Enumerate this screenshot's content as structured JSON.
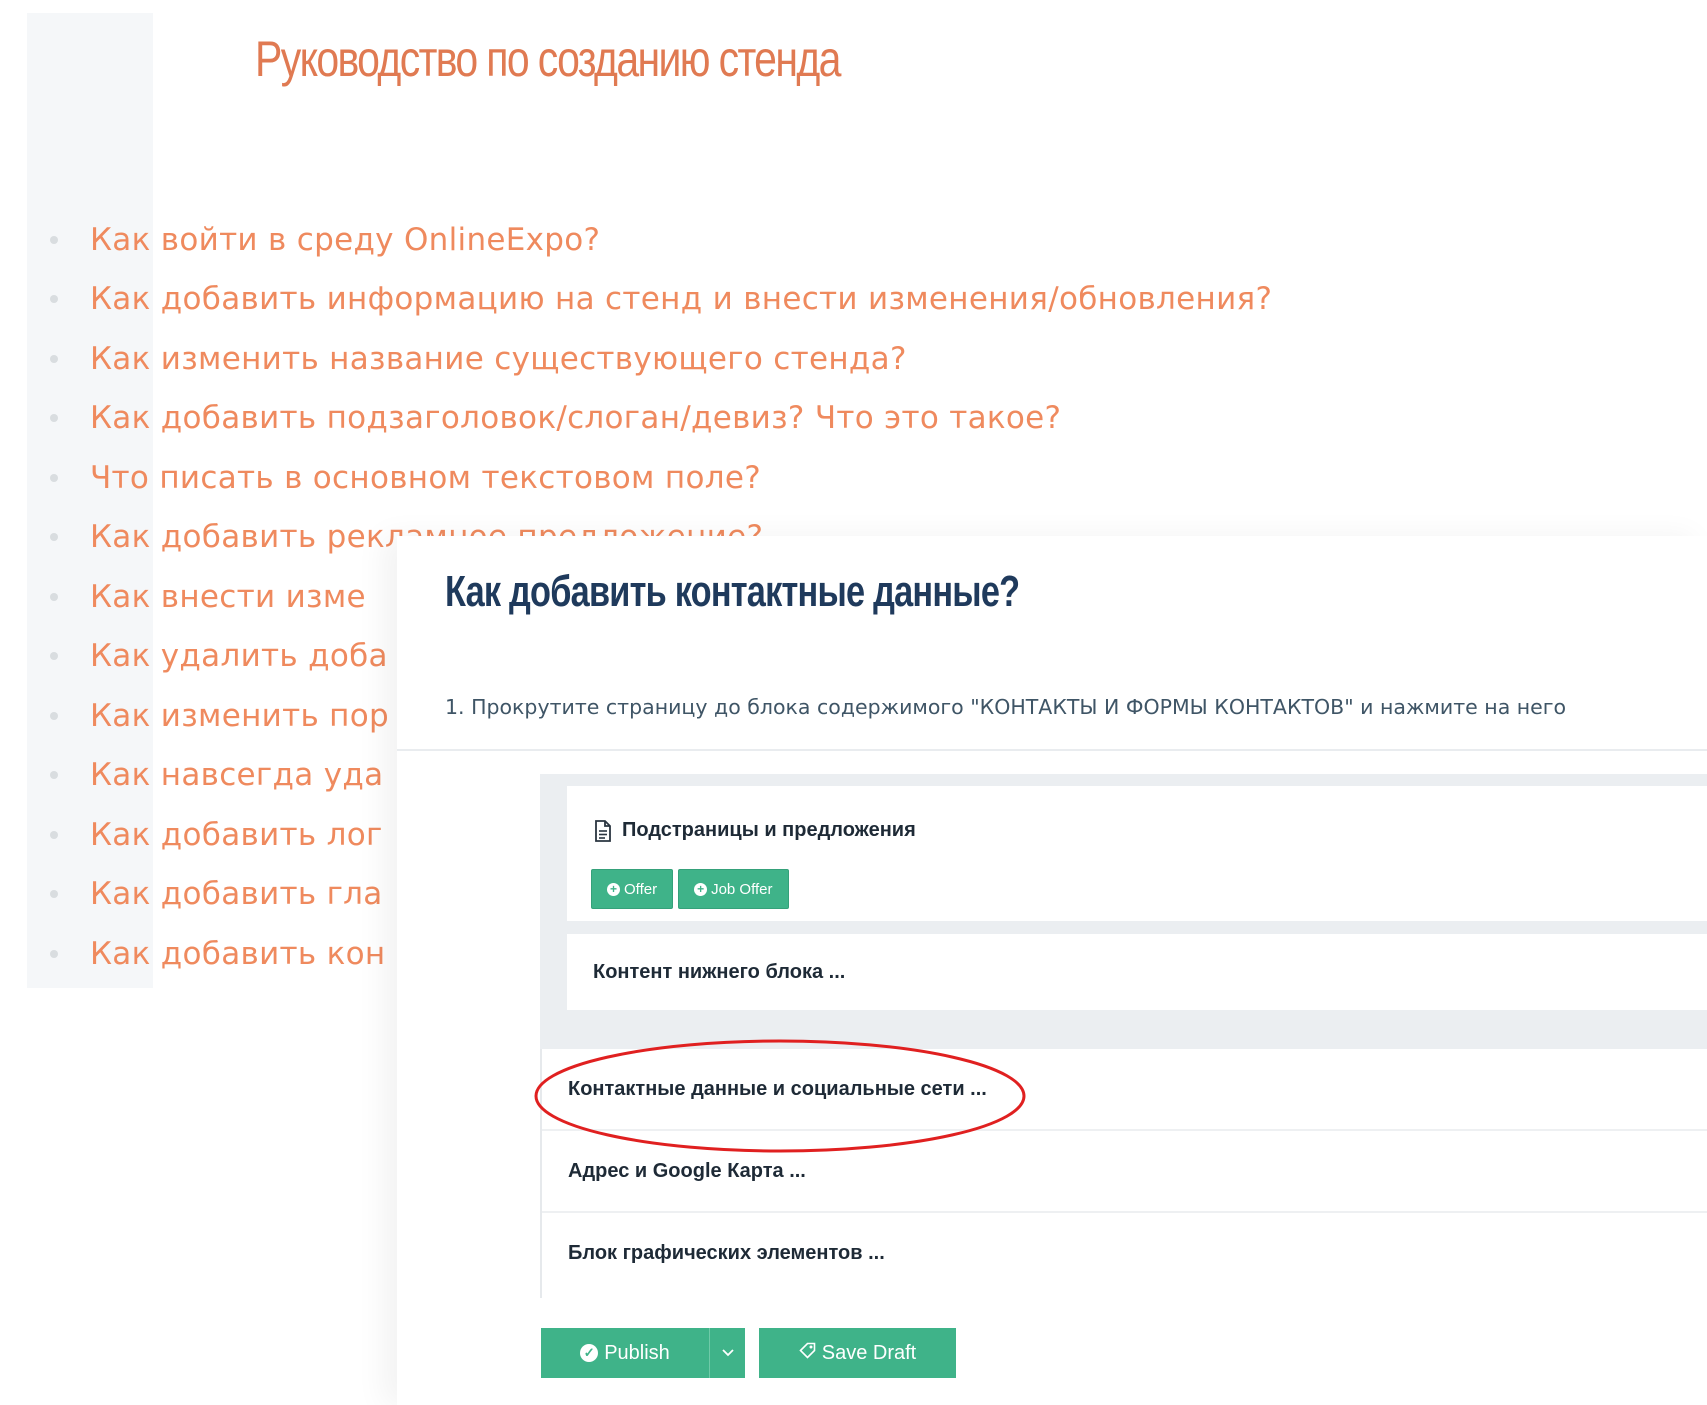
{
  "guide": {
    "title": "Руководство по созданию стенда",
    "items": [
      "Как войти в среду OnlineExpo?",
      "Как добавить информацию на стенд и внести изменения/обновления?",
      "Как изменить название существующего стенда?",
      "Как добавить подзаголовок/слоган/девиз? Что это такое?",
      "Что писать в основном текстовом поле?",
      "Как добавить рекламное предложение?",
      "Как внести изме",
      "Как удалить доба",
      "Как изменить пор",
      "Как навсегда уда",
      "Как добавить лог",
      "Как добавить гла",
      "Как добавить кон"
    ]
  },
  "step": {
    "title": "Как добавить контактные данные?",
    "instruction": "1. Прокрутите страницу до блока содержимого \"КОНТАКТЫ И ФОРМЫ КОНТАКТОВ\" и нажмите на него"
  },
  "admin": {
    "subpages_heading": "Подстраницы и предложения",
    "offer_button": "Offer",
    "job_offer_button": "Job Offer",
    "bottom_block_label": "Контент нижнего блока ...",
    "rows": [
      "Контактные данные и социальные сети ...",
      "Адрес и Google Карта ...",
      "Блок графических элементов ..."
    ],
    "publish_label": "Publish",
    "save_draft_label": "Save Draft",
    "highlight_color": "#e02020",
    "accent_color": "#3fb389"
  },
  "icons": [
    "document-icon",
    "plus-circle-icon",
    "check-circle-icon",
    "chevron-down-icon",
    "tag-icon"
  ]
}
